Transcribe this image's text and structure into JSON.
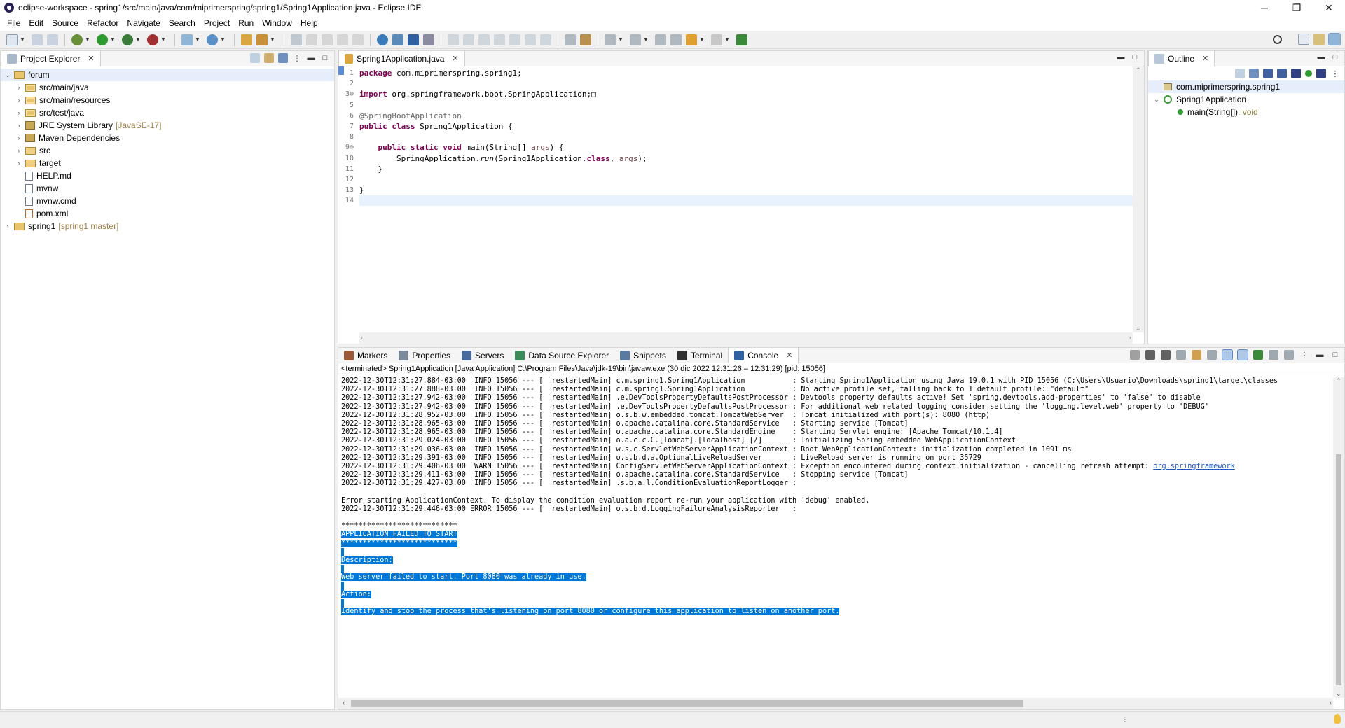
{
  "window": {
    "title": "eclipse-workspace - spring1/src/main/java/com/miprimerspring/spring1/Spring1Application.java - Eclipse IDE",
    "minimize": "─",
    "restore": "❐",
    "close": "✕"
  },
  "menu": [
    "File",
    "Edit",
    "Source",
    "Refactor",
    "Navigate",
    "Search",
    "Project",
    "Run",
    "Window",
    "Help"
  ],
  "project_explorer": {
    "tab_label": "Project Explorer",
    "tree": [
      {
        "label": "forum",
        "decor": "",
        "level": 0,
        "expanded": true,
        "icon": "project-icon",
        "selected": true
      },
      {
        "label": "src/main/java",
        "decor": "",
        "level": 1,
        "expanded": false,
        "icon": "source-folder-icon"
      },
      {
        "label": "src/main/resources",
        "decor": "",
        "level": 1,
        "expanded": false,
        "icon": "source-folder-icon"
      },
      {
        "label": "src/test/java",
        "decor": "",
        "level": 1,
        "expanded": false,
        "icon": "source-folder-icon"
      },
      {
        "label": "JRE System Library",
        "decor": "[JavaSE-17]",
        "level": 1,
        "expanded": false,
        "icon": "library-icon"
      },
      {
        "label": "Maven Dependencies",
        "decor": "",
        "level": 1,
        "expanded": false,
        "icon": "library-icon"
      },
      {
        "label": "src",
        "decor": "",
        "level": 1,
        "expanded": false,
        "icon": "folder-icon"
      },
      {
        "label": "target",
        "decor": "",
        "level": 1,
        "expanded": false,
        "icon": "folder-icon"
      },
      {
        "label": "HELP.md",
        "decor": "",
        "level": 1,
        "leaf": true,
        "icon": "file-icon"
      },
      {
        "label": "mvnw",
        "decor": "",
        "level": 1,
        "leaf": true,
        "icon": "file-icon"
      },
      {
        "label": "mvnw.cmd",
        "decor": "",
        "level": 1,
        "leaf": true,
        "icon": "file-icon"
      },
      {
        "label": "pom.xml",
        "decor": "",
        "level": 1,
        "leaf": true,
        "icon": "xml-file-icon"
      },
      {
        "label": "spring1",
        "decor": "[spring1 master]",
        "level": 0,
        "expanded": false,
        "icon": "project-icon"
      }
    ]
  },
  "editor": {
    "tab_label": "Spring1Application.java",
    "lines": [
      {
        "n": "1",
        "tokens": [
          {
            "t": "package",
            "c": "kw"
          },
          {
            "t": " com.miprimerspring.spring1;",
            "c": ""
          }
        ]
      },
      {
        "n": "2",
        "tokens": []
      },
      {
        "n": "3⊕",
        "tokens": [
          {
            "t": "import",
            "c": "kw"
          },
          {
            "t": " org.springframework.boot.SpringApplication;",
            "c": ""
          },
          {
            "t": "□",
            "c": ""
          }
        ]
      },
      {
        "n": "5",
        "tokens": []
      },
      {
        "n": "6",
        "tokens": [
          {
            "t": "@SpringBootApplication",
            "c": "ann"
          }
        ]
      },
      {
        "n": "7",
        "tokens": [
          {
            "t": "public",
            "c": "kw"
          },
          {
            "t": " ",
            "c": ""
          },
          {
            "t": "class",
            "c": "kw"
          },
          {
            "t": " Spring1Application {",
            "c": ""
          }
        ]
      },
      {
        "n": "8",
        "tokens": []
      },
      {
        "n": "9⊖",
        "tokens": [
          {
            "t": "    ",
            "c": ""
          },
          {
            "t": "public",
            "c": "kw"
          },
          {
            "t": " ",
            "c": ""
          },
          {
            "t": "static",
            "c": "kw"
          },
          {
            "t": " ",
            "c": ""
          },
          {
            "t": "void",
            "c": "kw"
          },
          {
            "t": " main(String[] ",
            "c": ""
          },
          {
            "t": "args",
            "c": "param"
          },
          {
            "t": ") {",
            "c": ""
          }
        ]
      },
      {
        "n": "10",
        "tokens": [
          {
            "t": "        SpringApplication.",
            "c": ""
          },
          {
            "t": "run",
            "c": "ital"
          },
          {
            "t": "(Spring1Application.",
            "c": ""
          },
          {
            "t": "class",
            "c": "kw"
          },
          {
            "t": ", ",
            "c": ""
          },
          {
            "t": "args",
            "c": "param"
          },
          {
            "t": ");",
            "c": ""
          }
        ]
      },
      {
        "n": "11",
        "tokens": [
          {
            "t": "    }",
            "c": ""
          }
        ]
      },
      {
        "n": "12",
        "tokens": []
      },
      {
        "n": "13",
        "tokens": [
          {
            "t": "}",
            "c": ""
          }
        ]
      },
      {
        "n": "14",
        "tokens": [],
        "current": true
      }
    ]
  },
  "bottom_tabs": [
    {
      "label": "Markers",
      "icon": "markers-icon",
      "active": false
    },
    {
      "label": "Properties",
      "icon": "properties-icon",
      "active": false
    },
    {
      "label": "Servers",
      "icon": "servers-icon",
      "active": false
    },
    {
      "label": "Data Source Explorer",
      "icon": "data-source-icon",
      "active": false
    },
    {
      "label": "Snippets",
      "icon": "snippets-icon",
      "active": false
    },
    {
      "label": "Terminal",
      "icon": "terminal-icon",
      "active": false
    },
    {
      "label": "Console",
      "icon": "console-icon",
      "active": true
    }
  ],
  "console": {
    "header": "<terminated> Spring1Application [Java Application] C:\\Program Files\\Java\\jdk-19\\bin\\javaw.exe  (30 dic 2022 12:31:26 – 12:31:29) [pid: 15056]",
    "lines": [
      {
        "text": "2022-12-30T12:31:27.884-03:00  INFO 15056 --- [  restartedMain] c.m.spring1.Spring1Application           : Starting Spring1Application using Java 19.0.1 with PID 15056 (C:\\Users\\Usuario\\Downloads\\spring1\\target\\classes"
      },
      {
        "text": "2022-12-30T12:31:27.888-03:00  INFO 15056 --- [  restartedMain] c.m.spring1.Spring1Application           : No active profile set, falling back to 1 default profile: \"default\""
      },
      {
        "text": "2022-12-30T12:31:27.942-03:00  INFO 15056 --- [  restartedMain] .e.DevToolsPropertyDefaultsPostProcessor : Devtools property defaults active! Set 'spring.devtools.add-properties' to 'false' to disable"
      },
      {
        "text": "2022-12-30T12:31:27.942-03:00  INFO 15056 --- [  restartedMain] .e.DevToolsPropertyDefaultsPostProcessor : For additional web related logging consider setting the 'logging.level.web' property to 'DEBUG'"
      },
      {
        "text": "2022-12-30T12:31:28.952-03:00  INFO 15056 --- [  restartedMain] o.s.b.w.embedded.tomcat.TomcatWebServer  : Tomcat initialized with port(s): 8080 (http)"
      },
      {
        "text": "2022-12-30T12:31:28.965-03:00  INFO 15056 --- [  restartedMain] o.apache.catalina.core.StandardService   : Starting service [Tomcat]"
      },
      {
        "text": "2022-12-30T12:31:28.965-03:00  INFO 15056 --- [  restartedMain] o.apache.catalina.core.StandardEngine    : Starting Servlet engine: [Apache Tomcat/10.1.4]"
      },
      {
        "text": "2022-12-30T12:31:29.024-03:00  INFO 15056 --- [  restartedMain] o.a.c.c.C.[Tomcat].[localhost].[/]       : Initializing Spring embedded WebApplicationContext"
      },
      {
        "text": "2022-12-30T12:31:29.036-03:00  INFO 15056 --- [  restartedMain] w.s.c.ServletWebServerApplicationContext : Root WebApplicationContext: initialization completed in 1091 ms"
      },
      {
        "text": "2022-12-30T12:31:29.391-03:00  INFO 15056 --- [  restartedMain] o.s.b.d.a.OptionalLiveReloadServer       : LiveReload server is running on port 35729"
      },
      {
        "text": "2022-12-30T12:31:29.406-03:00  WARN 15056 --- [  restartedMain] ConfigServletWebServerApplicationContext : Exception encountered during context initialization - cancelling refresh attempt: ",
        "link": "org.springframework"
      },
      {
        "text": "2022-12-30T12:31:29.411-03:00  INFO 15056 --- [  restartedMain] o.apache.catalina.core.StandardService   : Stopping service [Tomcat]"
      },
      {
        "text": "2022-12-30T12:31:29.427-03:00  INFO 15056 --- [  restartedMain] .s.b.a.l.ConditionEvaluationReportLogger : "
      },
      {
        "text": ""
      },
      {
        "text": "Error starting ApplicationContext. To display the condition evaluation report re-run your application with 'debug' enabled."
      },
      {
        "text": "2022-12-30T12:31:29.446-03:00 ERROR 15056 --- [  restartedMain] o.s.b.d.LoggingFailureAnalysisReporter   : "
      },
      {
        "text": ""
      },
      {
        "text": "***************************",
        "sel": false
      },
      {
        "text": "APPLICATION FAILED TO START",
        "sel": true
      },
      {
        "text": "***************************",
        "sel": true
      },
      {
        "text": "",
        "sel": true
      },
      {
        "text": "Description:",
        "sel": true
      },
      {
        "text": "",
        "sel": true
      },
      {
        "text": "Web server failed to start. Port 8080 was already in use.",
        "sel": true
      },
      {
        "text": "",
        "sel": true
      },
      {
        "text": "Action:",
        "sel": true
      },
      {
        "text": "",
        "sel": true
      },
      {
        "text": "Identify and stop the process that's listening on port 8080 or configure this application to listen on another port.",
        "sel": true
      },
      {
        "text": "",
        "sel": false
      }
    ]
  },
  "outline": {
    "tab_label": "Outline",
    "items": [
      {
        "label": "com.miprimerspring.spring1",
        "ret": "",
        "level": 0,
        "icon": "package-icon",
        "selected": true
      },
      {
        "label": "Spring1Application",
        "ret": "",
        "level": 0,
        "icon": "class-icon",
        "expanded": true
      },
      {
        "label": "main(String[])",
        "ret": " : void",
        "level": 1,
        "icon": "method-icon"
      }
    ]
  }
}
